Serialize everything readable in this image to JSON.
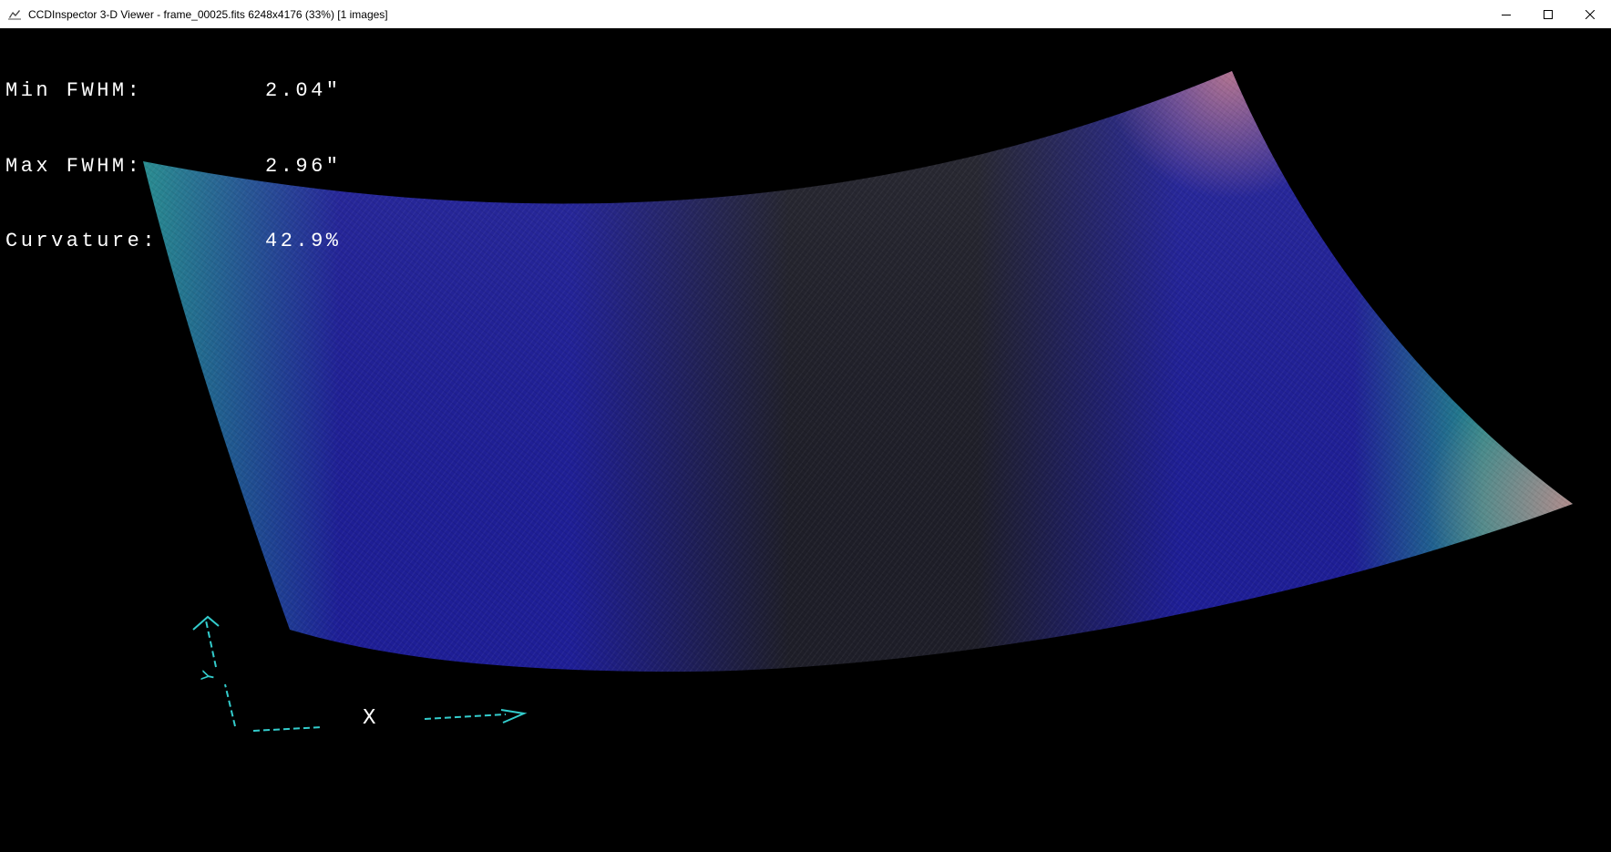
{
  "window": {
    "title": "CCDInspector 3-D Viewer - frame_00025.fits 6248x4176 (33%)  [1 images]",
    "controls": {
      "minimize": "minimize-icon",
      "maximize": "maximize-icon",
      "close": "close-icon"
    }
  },
  "stats": {
    "min_fwhm_label": "Min FWHM:",
    "min_fwhm_value": "2.04\"",
    "max_fwhm_label": "Max FWHM:",
    "max_fwhm_value": "2.96\"",
    "curvature_label": "Curvature:",
    "curvature_value": "42.9%"
  },
  "axes": {
    "x_label": "X",
    "y_label": "Y",
    "color": "#33cccc"
  },
  "surface": {
    "colormap": {
      "low": "#1e1e28",
      "mid": "#1e1e96",
      "high_mid": "#208c8c",
      "high": "#e08c8c"
    }
  }
}
